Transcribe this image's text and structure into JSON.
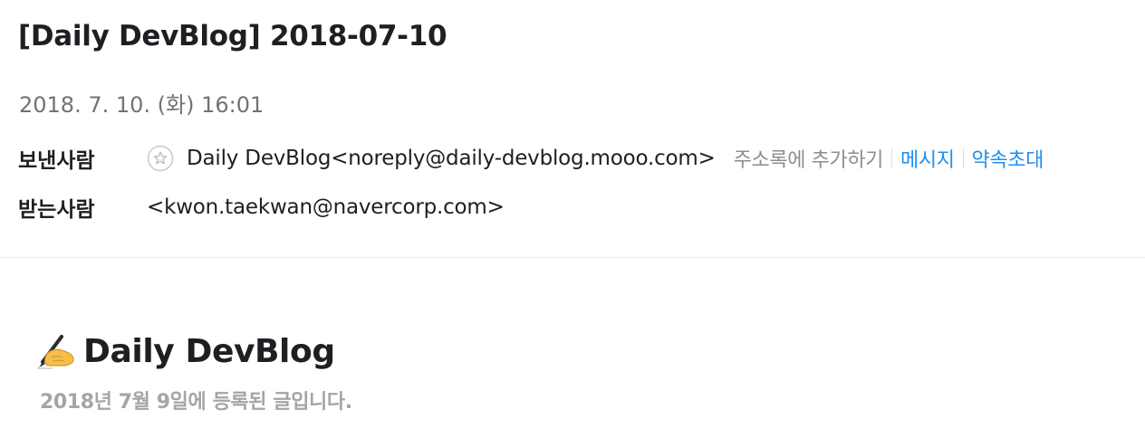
{
  "mail": {
    "subject": "[Daily DevBlog] 2018-07-10",
    "date": "2018. 7. 10. (화) 16:01",
    "sender": {
      "label": "보낸사람",
      "address": "Daily DevBlog<noreply@daily-devblog.mooo.com>",
      "icon": "star-icon",
      "actions": {
        "add_contact": "주소록에 추가하기",
        "message": "메시지",
        "invite": "약속초대"
      }
    },
    "recipient": {
      "label": "받는사람",
      "address": "<kwon.taekwan@navercorp.com>"
    }
  },
  "content": {
    "title_icon": "writing-hand-icon",
    "title": "Daily DevBlog",
    "subtitle": "2018년 7월 9일에 등록된 글입니다."
  },
  "colors": {
    "link": "#1f8ff0",
    "muted": "#8a8d93",
    "subtitle": "#a3a5aa"
  }
}
